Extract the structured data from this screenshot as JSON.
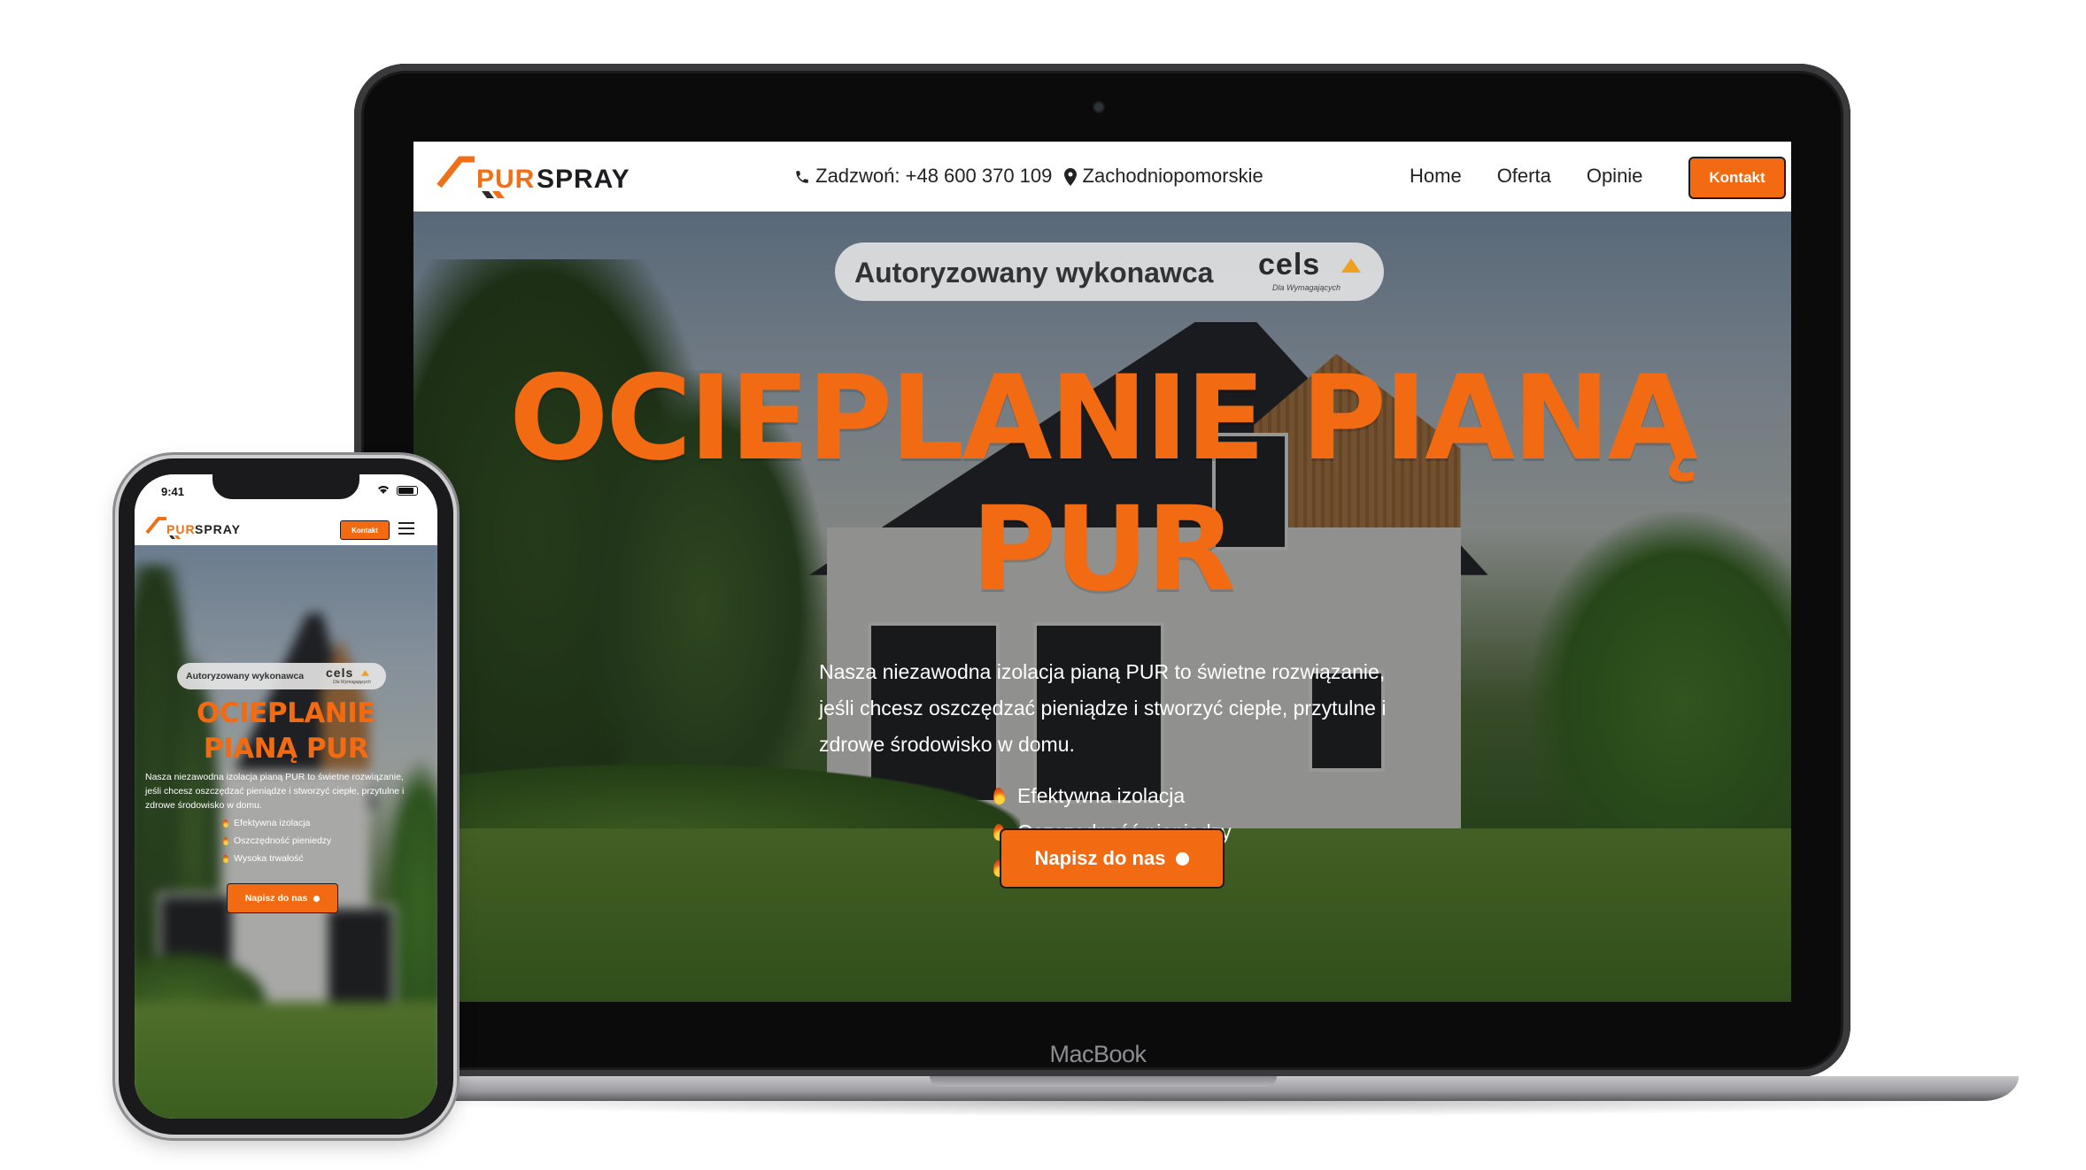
{
  "site": {
    "logo": {
      "part1": "PUR",
      "part2": "SPRAY"
    },
    "nav": {
      "phone_label": "Zadzwoń: +48 600 370 109",
      "region": "Zachodniopomorskie",
      "menu": [
        "Home",
        "Oferta",
        "Opinie"
      ],
      "cta": "Kontakt"
    },
    "hero": {
      "badge": "Autoryzowany wykonawca",
      "partner_logo": "cels",
      "partner_tagline": "Dla Wymagających",
      "title_line1": "OCIEPLANIE PIANĄ",
      "title_line2": "PUR",
      "mobile_title_line1": "OCIEPLANIE",
      "mobile_title_line2": "PIANĄ PUR",
      "description": "Nasza niezawodna izolacja pianą PUR to świetne rozwiązanie, jeśli chcesz oszczędzać pieniądze i stworzyć ciepłe, przytulne i zdrowe środowisko w domu.",
      "features": [
        "Efektywna izolacja",
        "Oszczędność pieniedzy",
        "Wysoka trwałość"
      ],
      "cta": "Napisz do nas"
    }
  },
  "device": {
    "laptop_brand": "MacBook",
    "phone_time": "9:41"
  },
  "colors": {
    "accent": "#f26b12",
    "nav_text": "#222222",
    "badge_bg": "#e6e6e6"
  },
  "icons": [
    "phone-icon",
    "map-pin-icon",
    "flame-icon",
    "chat-bubble-icon",
    "hamburger-menu-icon",
    "wifi-icon",
    "battery-icon"
  ]
}
